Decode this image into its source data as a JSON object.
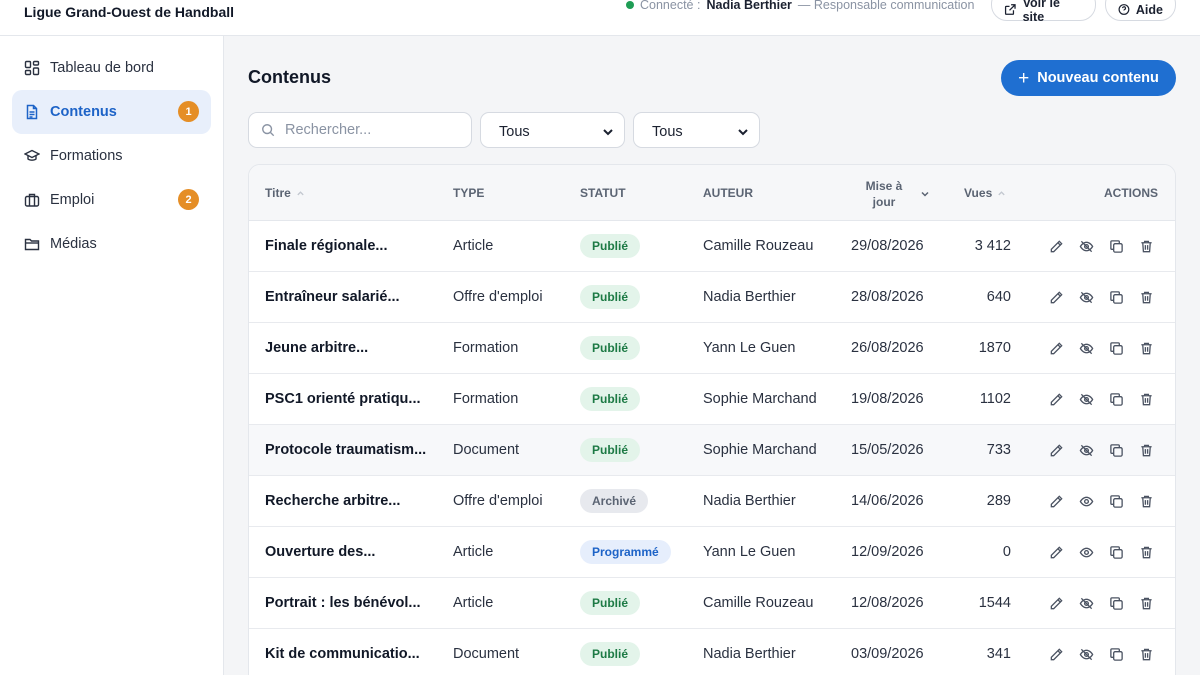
{
  "app": {
    "title": "Ligue Grand-Ouest de Handball"
  },
  "session": {
    "prefix": "Connecté :",
    "user": "Nadia Berthier",
    "role": "— Responsable communication"
  },
  "topbar": {
    "view_site": "Voir le site",
    "help": "Aide"
  },
  "sidebar": {
    "items": [
      {
        "label": "Tableau de bord",
        "icon": "dashboard-icon",
        "badge": ""
      },
      {
        "label": "Contenus",
        "icon": "document-icon",
        "badge": "1"
      },
      {
        "label": "Formations",
        "icon": "graduation-cap-icon",
        "badge": ""
      },
      {
        "label": "Emploi",
        "icon": "briefcase-icon",
        "badge": "2"
      },
      {
        "label": "Médias",
        "icon": "folder-icon",
        "badge": ""
      }
    ]
  },
  "main": {
    "title": "Contenus",
    "new_button": "Nouveau contenu",
    "search_placeholder": "Rechercher...",
    "filter_type": "Tous",
    "filter_status": "Tous"
  },
  "table": {
    "columns": {
      "title": "Titre",
      "type": "TYPE",
      "status": "STATUT",
      "author": "AUTEUR",
      "date_line1": "Mise à",
      "date_line2": "jour",
      "views": "Vues",
      "actions": "ACTIONS"
    },
    "rows": [
      {
        "title": "Finale régionale...",
        "type": "Article",
        "status": "Publié",
        "author": "Camille Rouzeau",
        "date": "29/08/2026",
        "views": "3 412",
        "visible": true
      },
      {
        "title": "Entraîneur salarié...",
        "type": "Offre d'emploi",
        "status": "Publié",
        "author": "Nadia Berthier",
        "date": "28/08/2026",
        "views": "640",
        "visible": true
      },
      {
        "title": "Jeune arbitre...",
        "type": "Formation",
        "status": "Publié",
        "author": "Yann Le Guen",
        "date": "26/08/2026",
        "views": "1870",
        "visible": true
      },
      {
        "title": "PSC1 orienté pratiqu...",
        "type": "Formation",
        "status": "Publié",
        "author": "Sophie Marchand",
        "date": "19/08/2026",
        "views": "1102",
        "visible": true
      },
      {
        "title": "Protocole traumatism...",
        "type": "Document",
        "status": "Publié",
        "author": "Sophie Marchand",
        "date": "15/05/2026",
        "views": "733",
        "visible": true
      },
      {
        "title": "Recherche arbitre...",
        "type": "Offre d'emploi",
        "status": "Archivé",
        "author": "Nadia Berthier",
        "date": "14/06/2026",
        "views": "289",
        "visible": false
      },
      {
        "title": "Ouverture des...",
        "type": "Article",
        "status": "Programmé",
        "author": "Yann Le Guen",
        "date": "12/09/2026",
        "views": "0",
        "visible": false
      },
      {
        "title": "Portrait : les bénévol...",
        "type": "Article",
        "status": "Publié",
        "author": "Camille Rouzeau",
        "date": "12/08/2026",
        "views": "1544",
        "visible": true
      },
      {
        "title": "Kit de communicatio...",
        "type": "Document",
        "status": "Publié",
        "author": "Nadia Berthier",
        "date": "03/09/2026",
        "views": "341",
        "visible": true
      }
    ]
  },
  "colors": {
    "accent": "#1f6fd1",
    "badge": "#e58e26",
    "published": "#1d7a45",
    "online": "#1f9d55"
  }
}
